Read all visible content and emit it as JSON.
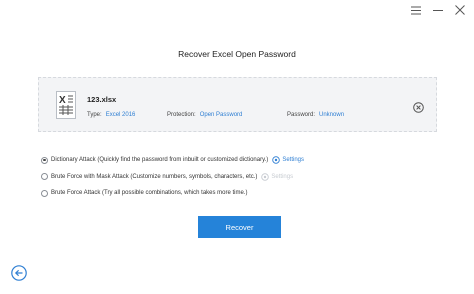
{
  "page": {
    "title": "Recover Excel Open Password"
  },
  "file": {
    "name": "123.xlsx",
    "type_label": "Type:",
    "type_value": "Excel 2016",
    "protection_label": "Protection:",
    "protection_value": "Open Password",
    "password_label": "Password:",
    "password_value": "Unknown"
  },
  "options": [
    {
      "label": "Dictionary Attack (Quickly find the password from inbuilt or customized dictionary.)",
      "selected": true,
      "settings_label": "Settings",
      "settings_enabled": true
    },
    {
      "label": "Brute Force with Mask Attack (Customize numbers, symbols, characters, etc.)",
      "selected": false,
      "settings_label": "Settings",
      "settings_enabled": false
    },
    {
      "label": "Brute Force Attack (Try all possible combinations, which takes more time.)",
      "selected": false
    }
  ],
  "actions": {
    "recover_label": "Recover"
  },
  "colors": {
    "accent": "#2583d9",
    "link": "#2f7fd3",
    "card_bg": "#f3f4f6"
  }
}
